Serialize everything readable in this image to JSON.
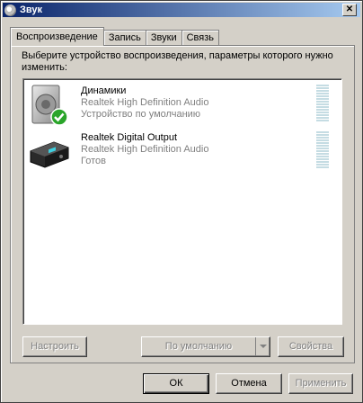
{
  "window": {
    "title": "Звук"
  },
  "tabs": [
    {
      "label": "Воспроизведение"
    },
    {
      "label": "Запись"
    },
    {
      "label": "Звуки"
    },
    {
      "label": "Связь"
    }
  ],
  "panel": {
    "instruction": "Выберите устройство воспроизведения, параметры которого нужно изменить:"
  },
  "devices": [
    {
      "name": "Динамики",
      "driver": "Realtek High Definition Audio",
      "status": "Устройство по умолчанию",
      "icon": "speaker-icon",
      "is_default": true
    },
    {
      "name": "Realtek Digital Output",
      "driver": "Realtek High Definition Audio",
      "status": "Готов",
      "icon": "digital-receiver-icon",
      "is_default": false
    }
  ],
  "panel_buttons": {
    "configure": "Настроить",
    "set_default": "По умолчанию",
    "properties": "Свойства"
  },
  "dialog_buttons": {
    "ok": "ОК",
    "cancel": "Отмена",
    "apply": "Применить"
  },
  "colors": {
    "title_start": "#0a246a",
    "title_end": "#a6caf0",
    "face": "#d4d0c8",
    "disabled_text": "#808080",
    "check_green": "#2aa52a",
    "level_meter": "#c5dce3"
  }
}
